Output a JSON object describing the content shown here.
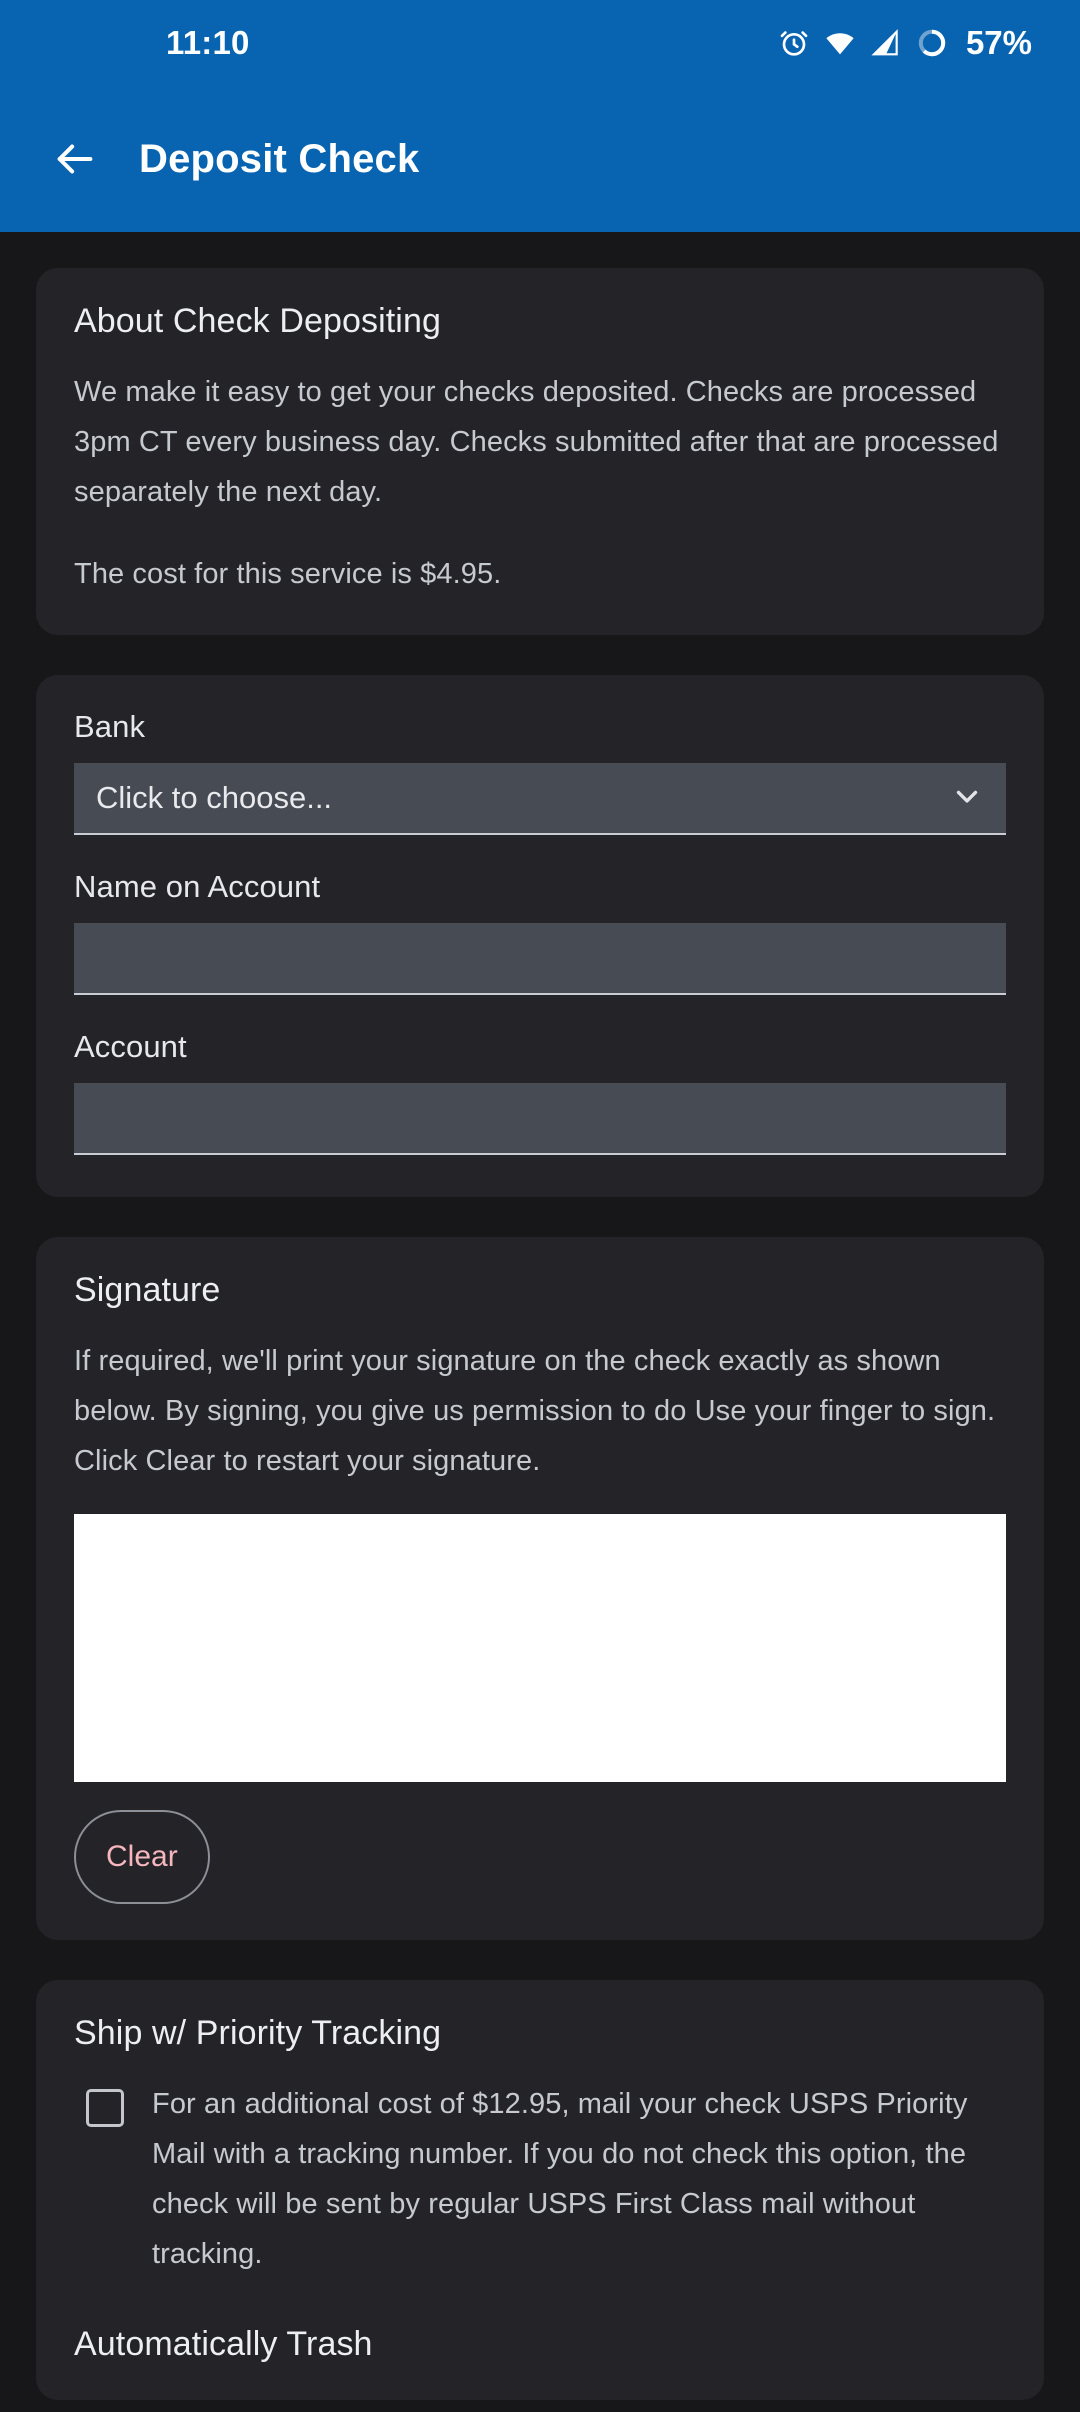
{
  "status_bar": {
    "clock": "11:10",
    "battery_percent": "57%",
    "icons": [
      "alarm-icon",
      "wifi-icon",
      "signal-icon",
      "battery-icon"
    ]
  },
  "app_bar": {
    "back_icon": "back-arrow-icon",
    "title": "Deposit Check",
    "background_color": "#0863b0"
  },
  "about_card": {
    "title": "About Check Depositing",
    "paragraph_1": "We make it easy to get your checks deposited. Checks are processed 3pm CT every business day. Checks submitted after that are processed separately the next day.",
    "paragraph_2": "The cost for this service is $4.95."
  },
  "form_card": {
    "bank": {
      "label": "Bank",
      "value": "Click to choose...",
      "chevron_icon": "chevron-down-icon"
    },
    "name_on_account": {
      "label": "Name on Account",
      "value": "",
      "placeholder": ""
    },
    "account": {
      "label": "Account",
      "value": "",
      "placeholder": ""
    }
  },
  "signature_card": {
    "title": "Signature",
    "description": "If required, we'll print your signature on the check exactly as shown below. By signing, you give us permission to do  Use your finger to sign. Click Clear to restart your signature.",
    "pad_color": "#ffffff",
    "clear_label": "Clear",
    "clear_text_color": "#f5b6bd"
  },
  "shipping_card": {
    "title": "Ship w/ Priority Tracking",
    "checkbox_checked": false,
    "checkbox_text": "For an additional cost of $12.95, mail your check USPS Priority Mail with a tracking number. If you do not check this option, the check will be sent by regular USPS First Class mail without tracking.",
    "auto_trash_title": "Automatically Trash"
  },
  "theme": {
    "page_background": "#17171a",
    "card_background": "#232328",
    "input_background": "#474b53",
    "accent_blue": "#0863b0"
  }
}
